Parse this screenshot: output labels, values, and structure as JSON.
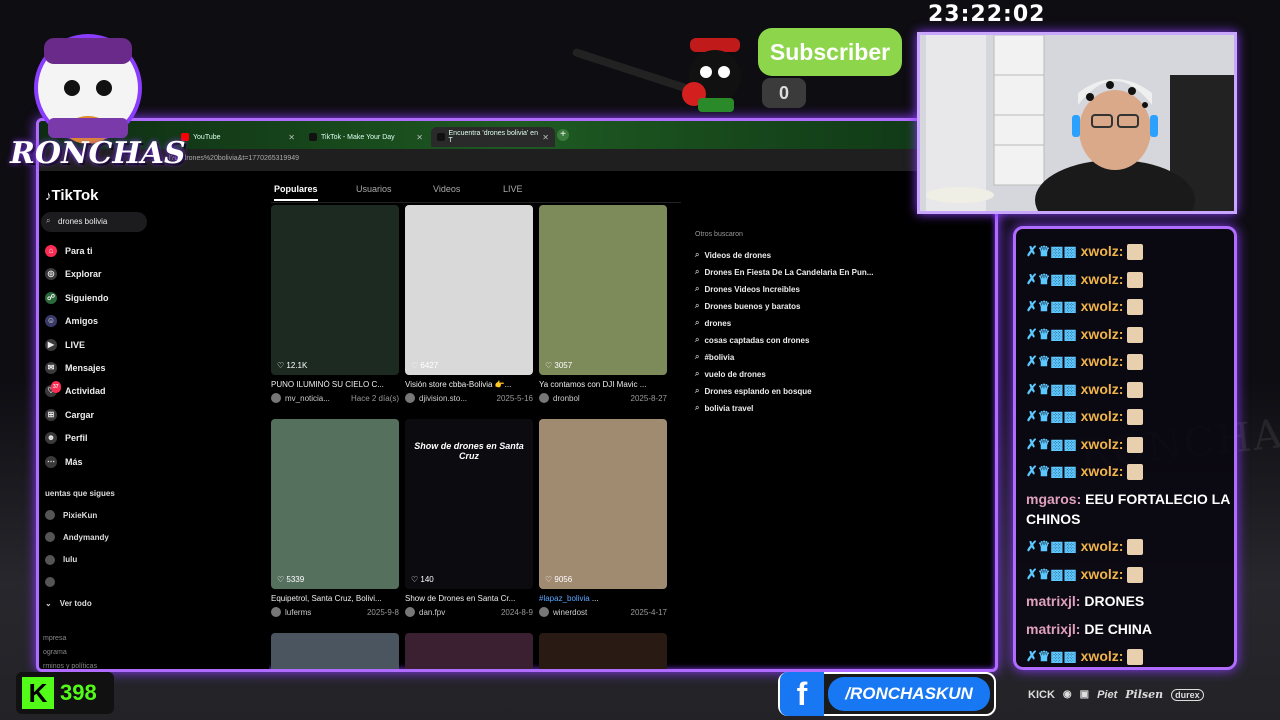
{
  "overlay": {
    "clock": "23:22:02",
    "logo_text": "RONCHAS",
    "subscriber_label": "Subscriber",
    "subscriber_count": "0",
    "kick_count": "398",
    "facebook_handle": "/RONCHASKUN",
    "sponsors": [
      "KICK",
      "Piet",
      "Pilsen",
      "durex"
    ],
    "watermark": "RONCHAS",
    "accent_color": "#b06cff",
    "kick_color": "#53fc18",
    "facebook_color": "#1877f2"
  },
  "browser": {
    "tabs": [
      {
        "label": "YouTube",
        "color": "#ff0000"
      },
      {
        "label": "TikTok - Make Your Day",
        "color": "#222222"
      },
      {
        "label": "Encuentra 'drones bolivia' en T",
        "color": "#222222"
      }
    ],
    "url": "l?q=drones%20bolivia&t=1770265319949"
  },
  "tiktok": {
    "logo": "TikTok",
    "search_value": "drones bolivia",
    "nav": [
      {
        "label": "Para ti",
        "icon": "home-icon"
      },
      {
        "label": "Explorar",
        "icon": "compass-icon"
      },
      {
        "label": "Siguiendo",
        "icon": "following-icon"
      },
      {
        "label": "Amigos",
        "icon": "friends-icon"
      },
      {
        "label": "LIVE",
        "icon": "live-icon"
      },
      {
        "label": "Mensajes",
        "icon": "message-icon"
      },
      {
        "label": "Actividad",
        "icon": "activity-icon",
        "badge": "37"
      },
      {
        "label": "Cargar",
        "icon": "upload-icon"
      },
      {
        "label": "Perfil",
        "icon": "profile-icon"
      },
      {
        "label": "Más",
        "icon": "more-icon"
      }
    ],
    "following_title": "uentas que sigues",
    "following": [
      "PixieKun",
      "Andymandy",
      "lulu",
      ""
    ],
    "see_all": "Ver todo",
    "footer": [
      "mpresa",
      "ograma",
      "rminos y políticas"
    ],
    "result_tabs": [
      "Populares",
      "Usuarios",
      "Videos",
      "LIVE"
    ],
    "videos": [
      {
        "likes": "12.1K",
        "caption": "PUNO ILUMINÓ SU CIELO C...",
        "user": "mv_noticia...",
        "date": "Hace 2 día(s)",
        "bg": "#1c2a22"
      },
      {
        "likes": "6427",
        "caption": "Visión store cbba-Bolivia 👉...",
        "user": "djivision.sto...",
        "date": "2025-5-16",
        "bg": "#d9d9d9"
      },
      {
        "likes": "3057",
        "caption": "Ya contamos con DJI Mavic ...",
        "user": "dronbol",
        "date": "2025-8-27",
        "bg": "#7d8a5a"
      },
      {
        "likes": "5339",
        "caption": "Equipetrol, Santa Cruz, Bolivi...",
        "user": "luferms",
        "date": "2025-9-8",
        "bg": "#56705e",
        "overlay": ""
      },
      {
        "likes": "140",
        "caption": "Show de Drones en Santa Cr...",
        "user": "dan.fpv",
        "date": "2024-8-9",
        "bg": "#0b0b10",
        "overlay": "Show de drones en Santa Cruz"
      },
      {
        "likes": "9056",
        "caption": "#lapaz_bolivia",
        "caption_suffix": " ...",
        "user": "winerdost",
        "date": "2025-4-17",
        "bg": "#a08a70"
      }
    ],
    "also_searched_title": "Otros buscaron",
    "also_searched": [
      "Videos de drones",
      "Drones En Fiesta De La Candelaria En Pun...",
      "Drones Videos Increibles",
      "Drones buenos y baratos",
      "drones",
      "cosas captadas con drones",
      "#bolivia",
      "vuelo de drones",
      "Drones esplando en bosque",
      "bolivia travel"
    ]
  },
  "chat": {
    "messages": [
      {
        "user": "xwolz:",
        "text": "",
        "type": "badge"
      },
      {
        "user": "xwolz:",
        "text": "",
        "type": "badge"
      },
      {
        "user": "xwolz:",
        "text": "",
        "type": "badge"
      },
      {
        "user": "xwolz:",
        "text": "",
        "type": "badge"
      },
      {
        "user": "xwolz:",
        "text": "",
        "type": "badge"
      },
      {
        "user": "xwolz:",
        "text": "",
        "type": "badge"
      },
      {
        "user": "xwolz:",
        "text": "",
        "type": "badge"
      },
      {
        "user": "xwolz:",
        "text": "",
        "type": "badge"
      },
      {
        "user": "xwolz:",
        "text": "",
        "type": "badge"
      },
      {
        "user": "mgaros:",
        "text": "EEU FORTALECIO LA CHINOS",
        "type": "plain"
      },
      {
        "user": "xwolz:",
        "text": "",
        "type": "badge"
      },
      {
        "user": "xwolz:",
        "text": "",
        "type": "badge"
      },
      {
        "user": "matrixjl:",
        "text": "DRONES",
        "type": "plain"
      },
      {
        "user": "matrixjl:",
        "text": "DE CHINA",
        "type": "plain"
      },
      {
        "user": "xwolz:",
        "text": "",
        "type": "badge"
      }
    ]
  }
}
